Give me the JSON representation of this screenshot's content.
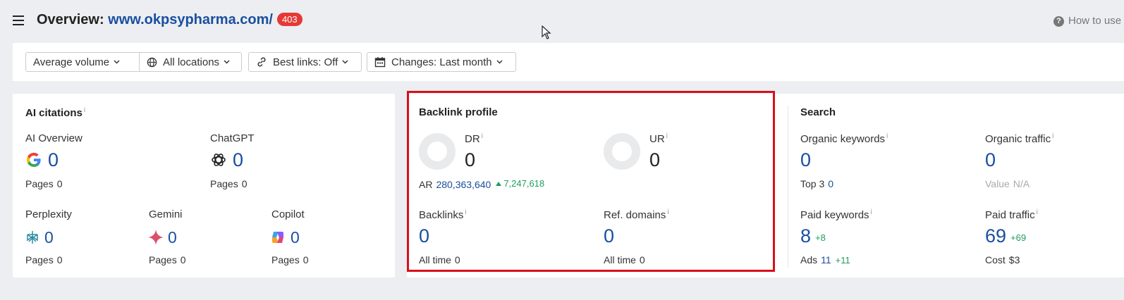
{
  "header": {
    "title_prefix": "Overview: ",
    "site_url": "www.okpsypharma.com/",
    "status_badge": "403",
    "help_label": "How to use"
  },
  "filters": [
    {
      "label": "Average volume"
    },
    {
      "label": "All locations"
    },
    {
      "label": "Best links: Off"
    },
    {
      "label": "Changes: Last month"
    }
  ],
  "ai_citations": {
    "title": "AI citations",
    "pages_label": "Pages",
    "ai_overview": {
      "label": "AI Overview",
      "value": "0",
      "pages": "0"
    },
    "chatgpt": {
      "label": "ChatGPT",
      "value": "0",
      "pages": "0"
    },
    "perplexity": {
      "label": "Perplexity",
      "value": "0",
      "pages": "0"
    },
    "gemini": {
      "label": "Gemini",
      "value": "0",
      "pages": "0"
    },
    "copilot": {
      "label": "Copilot",
      "value": "0",
      "pages": "0"
    }
  },
  "backlink_profile": {
    "title": "Backlink profile",
    "dr": {
      "label": "DR",
      "value": "0"
    },
    "ur": {
      "label": "UR",
      "value": "0"
    },
    "ar": {
      "label": "AR",
      "value": "280,363,640",
      "change": "7,247,618"
    },
    "backlinks": {
      "label": "Backlinks",
      "value": "0",
      "sub_label": "All time",
      "sub_value": "0"
    },
    "ref_domains": {
      "label": "Ref. domains",
      "value": "0",
      "sub_label": "All time",
      "sub_value": "0"
    }
  },
  "search": {
    "title": "Search",
    "organic_keywords": {
      "label": "Organic keywords",
      "value": "0",
      "sub_label": "Top 3",
      "sub_value": "0"
    },
    "organic_traffic": {
      "label": "Organic traffic",
      "value": "0",
      "sub_label": "Value",
      "sub_value": "N/A"
    },
    "paid_keywords": {
      "label": "Paid keywords",
      "value": "8",
      "delta": "+8",
      "sub_label": "Ads",
      "sub_value": "11",
      "sub_delta": "+11"
    },
    "paid_traffic": {
      "label": "Paid traffic",
      "value": "69",
      "delta": "+69",
      "sub_label": "Cost",
      "sub_value": "$3"
    }
  },
  "colors": {
    "accent": "#1a4fa0",
    "positive": "#1e9e5a",
    "badge": "#e53935",
    "highlight": "#d90f1b"
  }
}
